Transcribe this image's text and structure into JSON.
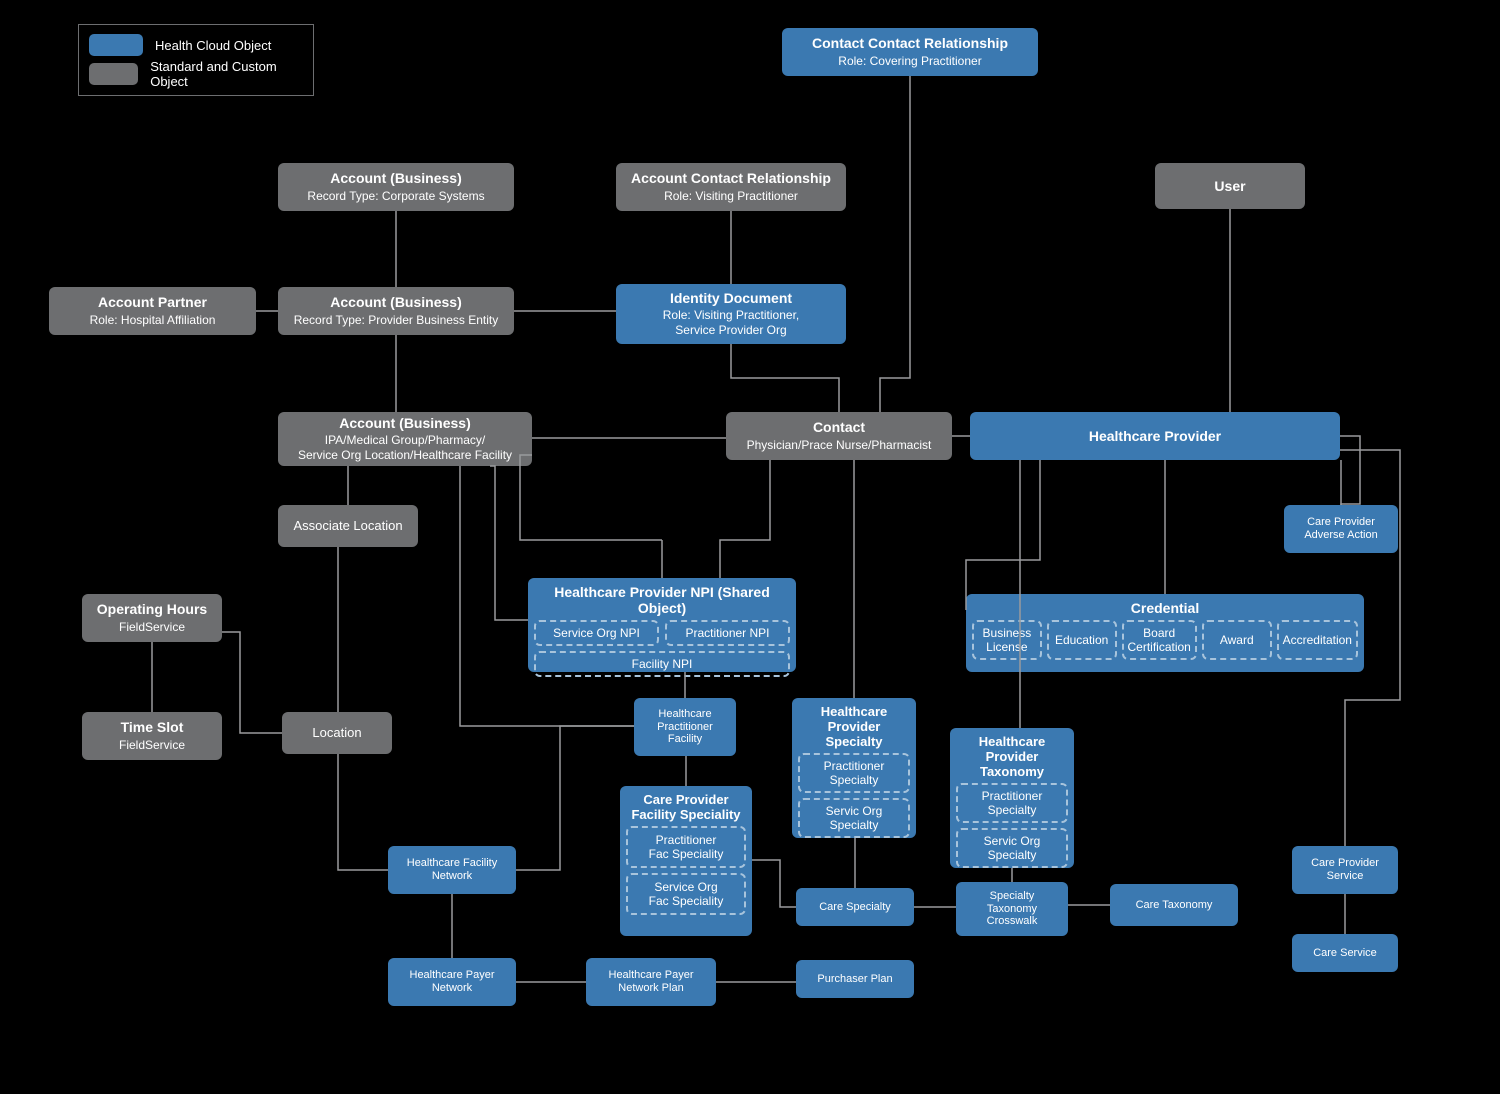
{
  "legend": {
    "cloud": "Health Cloud Object",
    "standard": "Standard and Custom Object"
  },
  "boxes": {
    "ccr": {
      "title": "Contact Contact Relationship",
      "sub": "Role: Covering Practitioner"
    },
    "acctCorp": {
      "title": "Account (Business)",
      "sub": "Record Type: Corporate Systems"
    },
    "acr": {
      "title": "Account Contact Relationship",
      "sub": "Role: Visiting Practitioner"
    },
    "user": {
      "title": "User"
    },
    "acctPartner": {
      "title": "Account Partner",
      "sub": "Role: Hospital Affiliation"
    },
    "acctPBE": {
      "title": "Account (Business)",
      "sub": "Record Type: Provider Business Entity"
    },
    "idDoc": {
      "title": "Identity Document",
      "sub": "Role: Visiting Practitioner,\nService Provider Org"
    },
    "acctIPA": {
      "title": "Account (Business)",
      "sub": "IPA/Medical Group/Pharmacy/\nService Org Location/Healthcare Facility"
    },
    "contact": {
      "title": "Contact",
      "sub": "Physician/Prace Nurse/Pharmacist"
    },
    "hcProvider": {
      "title": "Healthcare Provider"
    },
    "assocLoc": {
      "title": "Associate Location"
    },
    "opHours": {
      "title": "Operating Hours",
      "sub": "FieldService"
    },
    "timeslot": {
      "title": "Time Slot",
      "sub": "FieldService"
    },
    "location": {
      "title": "Location"
    },
    "hcFacNet": {
      "title": "Healthcare Facility\nNetwork"
    },
    "hcPayerNet": {
      "title": "Healthcare Payer\nNetwork"
    },
    "hcPayerPlan": {
      "title": "Healthcare Payer\nNetwork Plan"
    },
    "hpf": {
      "title": "Healthcare\nPractitioner\nFacility"
    },
    "careSpec": {
      "title": "Care Specialty"
    },
    "specCross": {
      "title": "Specialty\nTaxonomy\nCrosswalk"
    },
    "careTax": {
      "title": "Care Taxonomy"
    },
    "purchPlan": {
      "title": "Purchaser Plan"
    },
    "cpAdverse": {
      "title": "Care Provider\nAdverse Action"
    },
    "cpService": {
      "title": "Care Provider\nService"
    },
    "careService": {
      "title": "Care Service"
    }
  },
  "npi": {
    "title": "Healthcare Provider NPI (Shared Object)",
    "svc": "Service Org NPI",
    "prac": "Practitioner NPI",
    "fac": "Facility NPI"
  },
  "credential": {
    "title": "Credential",
    "items": [
      "Business\nLicense",
      "Education",
      "Board\nCertification",
      "Award",
      "Accreditation"
    ]
  },
  "cpfs": {
    "title": "Care Provider\nFacility Speciality",
    "a": "Practitioner\nFac Speciality",
    "b": "Service Org\nFac Speciality"
  },
  "hcps": {
    "title": "Healthcare\nProvider Specialty",
    "a": "Practitioner\nSpecialty",
    "b": "Servic Org\nSpecialty"
  },
  "hcpt": {
    "title": "Healthcare\nProvider Taxonomy",
    "a": "Practitioner\nSpecialty",
    "b": "Servic Org\nSpecialty"
  }
}
